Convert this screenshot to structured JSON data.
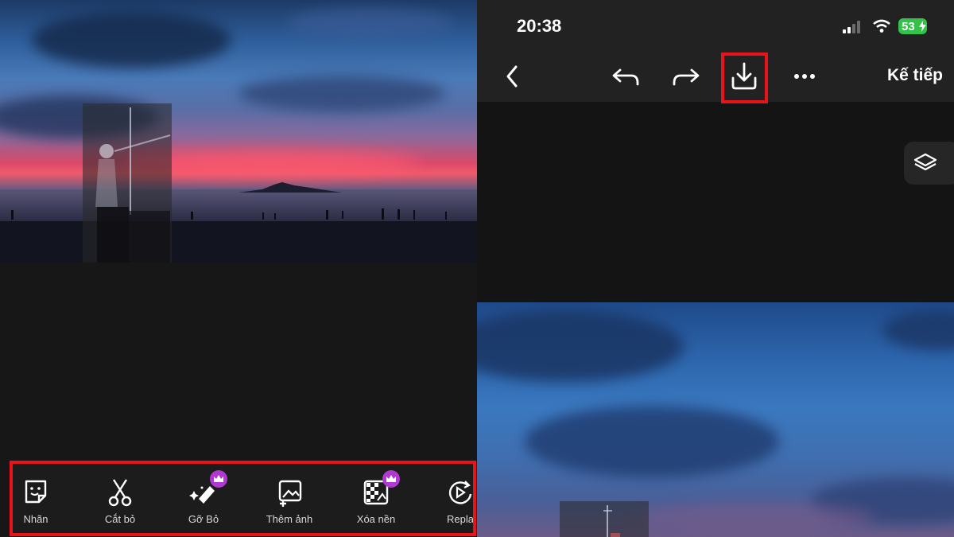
{
  "left_screen": {
    "tools": [
      {
        "label": "Nhãn",
        "icon": "sticker-icon",
        "premium": false
      },
      {
        "label": "Cắt bỏ",
        "icon": "scissors-icon",
        "premium": false
      },
      {
        "label": "Gỡ Bỏ",
        "icon": "eraser-magic-icon",
        "premium": true
      },
      {
        "label": "Thêm ảnh",
        "icon": "add-image-icon",
        "premium": true
      },
      {
        "label": "Xóa nền",
        "icon": "remove-background-icon",
        "premium": true
      },
      {
        "label": "Repla",
        "icon": "replace-icon",
        "premium": false
      }
    ]
  },
  "right_screen": {
    "status_bar": {
      "time": "20:38",
      "battery": "53"
    },
    "nav": {
      "next_label": "Kế tiếp"
    }
  },
  "colors": {
    "highlight": "#e8141a",
    "premium_badge": "#b03ad0",
    "background": "#161616",
    "nav_bar": "#222222"
  }
}
